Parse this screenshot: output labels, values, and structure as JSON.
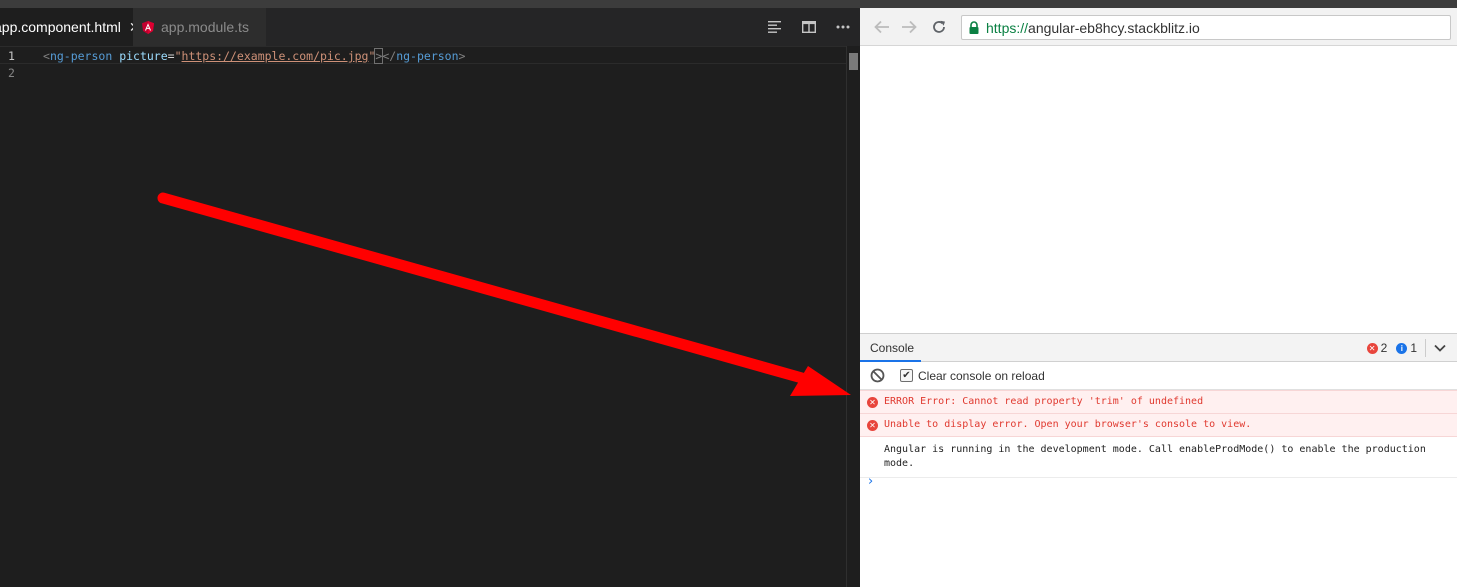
{
  "editor": {
    "tabs": [
      {
        "label": "app.component.html",
        "active": true
      },
      {
        "label": "app.module.ts",
        "active": false
      }
    ],
    "actions": [
      "format-icon",
      "split-editor-icon",
      "more-icon"
    ],
    "lines": [
      {
        "number": "1",
        "tokens": {
          "open": "<",
          "tag": "ng-person",
          "attr": "picture",
          "eq": "=",
          "quote_open": "\"",
          "value": "https://example.com/pic.jpg",
          "quote_close": "\"",
          "close": ">",
          "end_open": "</",
          "end_tag": "ng-person",
          "end_close": ">"
        }
      },
      {
        "number": "2"
      }
    ]
  },
  "browser": {
    "url_scheme": "https://",
    "url_host": "angular-eb8hcy.stackblitz.io",
    "console": {
      "tab_label": "Console",
      "error_count": "2",
      "info_count": "1",
      "clear_on_reload_label": "Clear console on reload",
      "clear_on_reload_checked": true,
      "messages": [
        {
          "type": "error",
          "text": "ERROR Error: Cannot read property 'trim' of undefined"
        },
        {
          "type": "error",
          "text": "Unable to display error. Open your browser's console to view."
        },
        {
          "type": "log",
          "text": "Angular is running in the development mode. Call enableProdMode() to enable the production mode."
        }
      ],
      "prompt": "›"
    }
  },
  "colors": {
    "editor_bg": "#1e1e1e",
    "tag": "#569cd6",
    "attr": "#9cdcfe",
    "string": "#ce9178",
    "error_text": "#e0392f",
    "error_bg": "#fff0f0",
    "arrow": "#ff0000",
    "secure_green": "#0b8043"
  }
}
